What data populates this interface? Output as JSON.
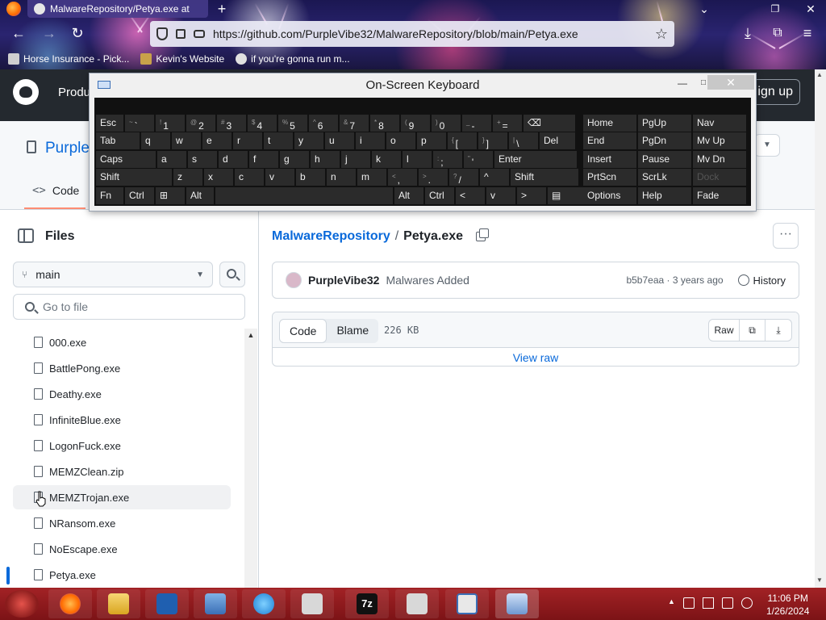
{
  "browser": {
    "tab_title": "MalwareRepository/Petya.exe at",
    "url": "https://github.com/PurpleVibe32/MalwareRepository/blob/main/Petya.exe",
    "bookmarks": [
      "Horse Insurance - Pick...",
      "Kevin's Website",
      "if you're gonna run m..."
    ]
  },
  "github": {
    "header_product": "Produ",
    "sign_up": "ign up",
    "repo_owner": "Purple",
    "code_tab": "Code"
  },
  "osk": {
    "title": "On-Screen Keyboard",
    "rows": [
      [
        {
          "m": "Esc"
        },
        {
          "s": "~",
          "m": "`"
        },
        {
          "s": "!",
          "m": "1"
        },
        {
          "s": "@",
          "m": "2"
        },
        {
          "s": "#",
          "m": "3"
        },
        {
          "s": "$",
          "m": "4"
        },
        {
          "s": "%",
          "m": "5"
        },
        {
          "s": "^",
          "m": "6"
        },
        {
          "s": "&",
          "m": "7"
        },
        {
          "s": "*",
          "m": "8"
        },
        {
          "s": "(",
          "m": "9"
        },
        {
          "s": ")",
          "m": "0"
        },
        {
          "s": "_",
          "m": "-"
        },
        {
          "s": "+",
          "m": "="
        },
        {
          "m": "⌫"
        }
      ],
      [
        {
          "m": "Tab"
        },
        {
          "m": "q"
        },
        {
          "m": "w"
        },
        {
          "m": "e"
        },
        {
          "m": "r"
        },
        {
          "m": "t"
        },
        {
          "m": "y"
        },
        {
          "m": "u"
        },
        {
          "m": "i"
        },
        {
          "m": "o"
        },
        {
          "m": "p"
        },
        {
          "s": "{",
          "m": "["
        },
        {
          "s": "}",
          "m": "]"
        },
        {
          "s": "|",
          "m": "\\"
        },
        {
          "m": "Del"
        }
      ],
      [
        {
          "m": "Caps"
        },
        {
          "m": "a"
        },
        {
          "m": "s"
        },
        {
          "m": "d"
        },
        {
          "m": "f"
        },
        {
          "m": "g"
        },
        {
          "m": "h"
        },
        {
          "m": "j"
        },
        {
          "m": "k"
        },
        {
          "m": "l"
        },
        {
          "s": ":",
          "m": ";"
        },
        {
          "s": "\"",
          "m": "'"
        },
        {
          "m": "Enter"
        }
      ],
      [
        {
          "m": "Shift"
        },
        {
          "m": "z"
        },
        {
          "m": "x"
        },
        {
          "m": "c"
        },
        {
          "m": "v"
        },
        {
          "m": "b"
        },
        {
          "m": "n"
        },
        {
          "m": "m"
        },
        {
          "s": "<",
          "m": ","
        },
        {
          "s": ">",
          "m": "."
        },
        {
          "s": "?",
          "m": "/"
        },
        {
          "m": "^"
        },
        {
          "m": "Shift"
        }
      ],
      [
        {
          "m": "Fn"
        },
        {
          "m": "Ctrl"
        },
        {
          "m": "⊞"
        },
        {
          "m": "Alt"
        },
        {
          "m": ""
        },
        {
          "m": "Alt"
        },
        {
          "m": "Ctrl"
        },
        {
          "m": "<"
        },
        {
          "m": "v"
        },
        {
          "m": ">"
        },
        {
          "m": "▤"
        }
      ]
    ],
    "nav_rows": [
      [
        "Home",
        "PgUp",
        "Nav"
      ],
      [
        "End",
        "PgDn",
        "Mv Up"
      ],
      [
        "Insert",
        "Pause",
        "Mv Dn"
      ],
      [
        "PrtScn",
        "ScrLk",
        "Dock"
      ],
      [
        "Options",
        "Help",
        "Fade"
      ]
    ]
  },
  "sidebar": {
    "title": "Files",
    "branch": "main",
    "goto_placeholder": "Go to file",
    "files": [
      "000.exe",
      "BattlePong.exe",
      "Deathy.exe",
      "InfiniteBlue.exe",
      "LogonFuck.exe",
      "MEMZClean.zip",
      "MEMZTrojan.exe",
      "NRansom.exe",
      "NoEscape.exe",
      "Petya.exe"
    ]
  },
  "main": {
    "breadcrumb_repo": "MalwareRepository",
    "breadcrumb_sep": "/",
    "breadcrumb_file": "Petya.exe",
    "commit_author": "PurpleVibe32",
    "commit_message": "Malwares Added",
    "commit_meta": "b5b7eaa · 3 years ago",
    "history": "History",
    "tab_code": "Code",
    "tab_blame": "Blame",
    "file_size": "226 KB",
    "raw": "Raw",
    "view_raw": "View raw"
  },
  "taskbar": {
    "time": "11:06 PM",
    "date": "1/26/2024"
  },
  "colors": {
    "link": "#0969da",
    "header": "#24292f",
    "taskbar": "#a22225"
  }
}
